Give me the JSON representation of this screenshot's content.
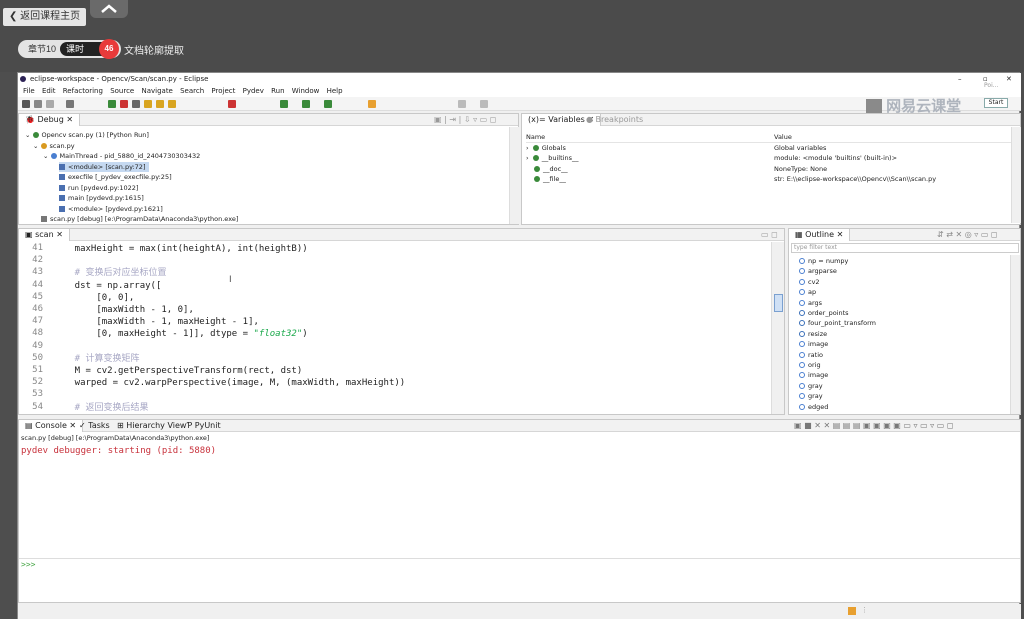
{
  "course": {
    "back_label": "返回课程主页",
    "chapter": "章节10",
    "lesson_label": "课时",
    "lesson_num": "46",
    "lesson_title": "文档轮廓提取"
  },
  "window": {
    "title": "eclipse-workspace - Opencv/Scan/scan.py - Eclipse"
  },
  "menu": [
    "File",
    "Edit",
    "Refactoring",
    "Source",
    "Navigate",
    "Search",
    "Project",
    "Pydev",
    "Run",
    "Window",
    "Help"
  ],
  "watermark": "网易云课堂",
  "perspective": {
    "items": [
      "Poi...",
      "Start"
    ]
  },
  "debug": {
    "tab": "Debug",
    "rows": [
      "Opencv scan.py (1) [Python Run]",
      "scan.py",
      "MainThread - pid_5880_id_2404730303432",
      "<module> [scan.py:72]",
      "execfile [_pydev_execfile.py:25]",
      "run [pydevd.py:1022]",
      "main [pydevd.py:1615]",
      "<module> [pydevd.py:1621]",
      "scan.py [debug] [e:\\ProgramData\\Anaconda3\\python.exe]"
    ]
  },
  "variables": {
    "tab": "Variables",
    "tab2": "Breakpoints",
    "col_name": "Name",
    "col_value": "Value",
    "rows": [
      {
        "name": "Globals",
        "value": "Global variables"
      },
      {
        "name": "__builtins__",
        "value": "module: <module 'builtins' (built-in)>"
      },
      {
        "name": "__doc__",
        "value": "NoneType: None"
      },
      {
        "name": "__file__",
        "value": "str: E:\\\\eclipse-workspace\\\\Opencv\\\\Scan\\\\scan.py"
      }
    ]
  },
  "editor": {
    "tab": "scan",
    "lines": [
      {
        "n": "41",
        "t": "    maxHeight = max(int(heightA), int(heightB))",
        "c": ""
      },
      {
        "n": "42",
        "t": "",
        "c": ""
      },
      {
        "n": "43",
        "t": "    # 变换后对应坐标位置",
        "c": "cm"
      },
      {
        "n": "44",
        "t": "    dst = np.array([",
        "c": ""
      },
      {
        "n": "45",
        "t": "        [0, 0],",
        "c": ""
      },
      {
        "n": "46",
        "t": "        [maxWidth - 1, 0],",
        "c": ""
      },
      {
        "n": "47",
        "t": "        [maxWidth - 1, maxHeight - 1],",
        "c": ""
      },
      {
        "n": "48",
        "t": "        [0, maxHeight - 1]], dtype = ",
        "c": "",
        "s": "\"float32\"",
        "e": ")"
      },
      {
        "n": "49",
        "t": "",
        "c": ""
      },
      {
        "n": "50",
        "t": "    # 计算变换矩阵",
        "c": "cm"
      },
      {
        "n": "51",
        "t": "    M = cv2.getPerspectiveTransform(rect, dst)",
        "c": ""
      },
      {
        "n": "52",
        "t": "    warped = cv2.warpPerspective(image, M, (maxWidth, maxHeight))",
        "c": ""
      },
      {
        "n": "53",
        "t": "",
        "c": ""
      },
      {
        "n": "54",
        "t": "    # 返回变换后结果",
        "c": "cm"
      }
    ]
  },
  "outline": {
    "tab": "Outline",
    "filter_placeholder": "type filter text",
    "items": [
      "np = numpy",
      "argparse",
      "cv2",
      "ap",
      "args",
      "order_points",
      "four_point_transform",
      "resize",
      "image",
      "ratio",
      "orig",
      "image",
      "gray",
      "gray",
      "edged"
    ]
  },
  "console": {
    "tabs": [
      "Console",
      "Tasks",
      "Hierarchy View",
      "PyUnit"
    ],
    "process": "scan.py [debug] [e:\\ProgramData\\Anaconda3\\python.exe]",
    "output": "pydev debugger: starting (pid: 5880)",
    "prompt": ">>>"
  },
  "colors": {
    "accent": "#e83a3a",
    "console_text": "#c8323c",
    "prompt": "#4aa84a",
    "comment": "#a7a7c4",
    "string": "#19a84a"
  }
}
